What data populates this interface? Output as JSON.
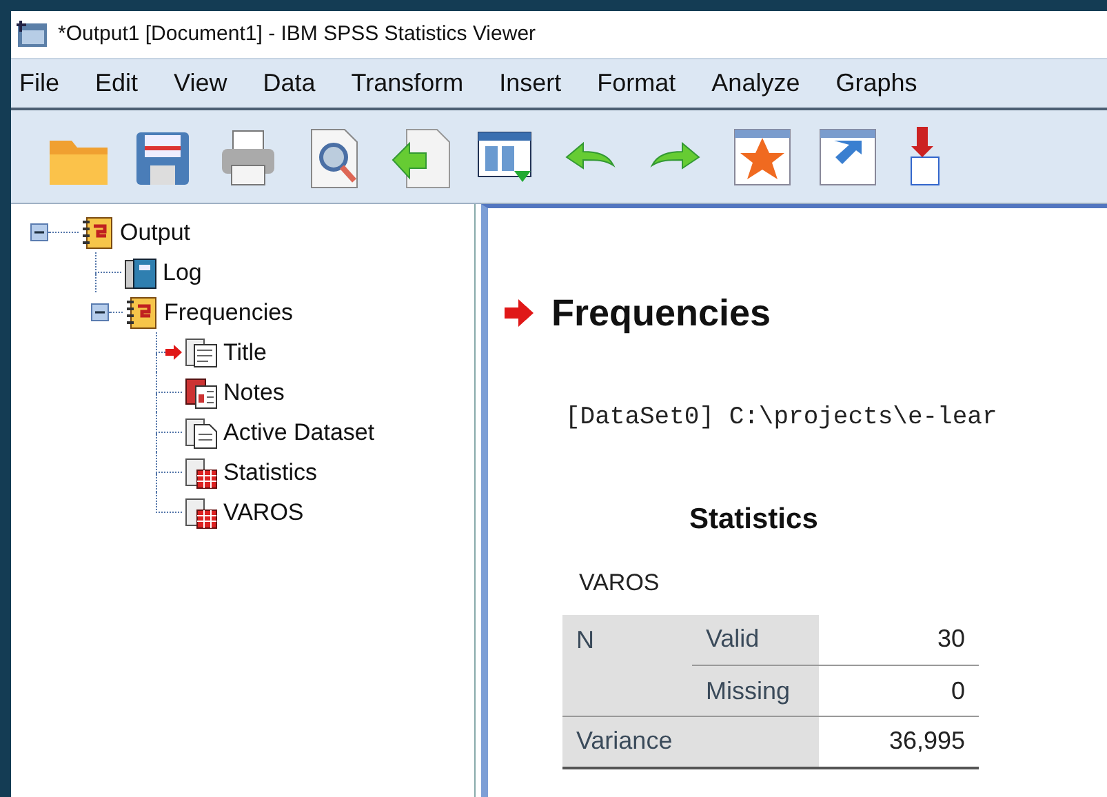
{
  "window": {
    "title": "*Output1 [Document1] - IBM SPSS Statistics Viewer"
  },
  "menu": [
    "File",
    "Edit",
    "View",
    "Data",
    "Transform",
    "Insert",
    "Format",
    "Analyze",
    "Graphs"
  ],
  "toolbar": [
    {
      "kind": "open"
    },
    {
      "kind": "save"
    },
    {
      "kind": "print"
    },
    {
      "kind": "preview"
    },
    {
      "kind": "export"
    },
    {
      "kind": "recall"
    },
    {
      "kind": "undo"
    },
    {
      "kind": "redo"
    },
    {
      "kind": "data"
    },
    {
      "kind": "variable"
    },
    {
      "kind": "insert"
    }
  ],
  "tree": [
    {
      "label": "Output",
      "kind": "book",
      "expanded": true,
      "selected": false,
      "children": [
        {
          "label": "Log",
          "kind": "log",
          "selected": false
        },
        {
          "label": "Frequencies",
          "kind": "book",
          "expanded": true,
          "selected": false,
          "children": [
            {
              "label": "Title",
              "kind": "title",
              "selected": true
            },
            {
              "label": "Notes",
              "kind": "notes",
              "selected": false
            },
            {
              "label": "Active Dataset",
              "kind": "text",
              "selected": false
            },
            {
              "label": "Statistics",
              "kind": "table",
              "selected": false
            },
            {
              "label": "VAROS",
              "kind": "table",
              "selected": false
            }
          ]
        }
      ]
    }
  ],
  "output": {
    "heading": "Frequencies",
    "heading_current": true,
    "dataset_line": "[DataSet0] C:\\projects\\e-lear",
    "table": {
      "title": "Statistics",
      "variable": "VAROS",
      "rows": [
        {
          "cells": [
            "N",
            "Valid",
            "30"
          ]
        },
        {
          "cells": [
            "",
            "Missing",
            "0"
          ]
        },
        {
          "cells": [
            "Variance",
            "",
            "36,995"
          ]
        }
      ]
    }
  }
}
